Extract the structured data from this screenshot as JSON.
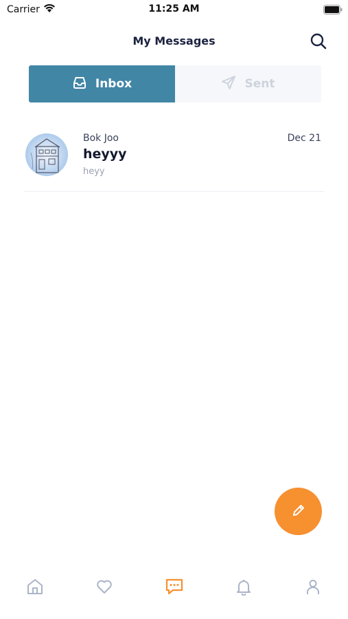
{
  "status_bar": {
    "carrier": "Carrier",
    "time": "11:25 AM"
  },
  "header": {
    "title": "My Messages",
    "search_icon": "search-icon"
  },
  "tabs": [
    {
      "label": "Inbox",
      "icon": "inbox-icon",
      "active": true
    },
    {
      "label": "Sent",
      "icon": "send-icon",
      "active": false
    }
  ],
  "messages": [
    {
      "sender": "Bok Joo",
      "date": "Dec 21",
      "subject": "heyyy",
      "preview": "heyy"
    }
  ],
  "fab": {
    "icon": "pencil-icon"
  },
  "bottom_nav": [
    {
      "icon": "home-icon",
      "active": false
    },
    {
      "icon": "heart-icon",
      "active": false
    },
    {
      "icon": "chat-icon",
      "active": true
    },
    {
      "icon": "bell-icon",
      "active": false
    },
    {
      "icon": "profile-icon",
      "active": false
    }
  ],
  "colors": {
    "primary": "#4286a6",
    "accent": "#f7902f",
    "inactive_icon": "#aab4c8",
    "text_dark": "#1c2340"
  }
}
